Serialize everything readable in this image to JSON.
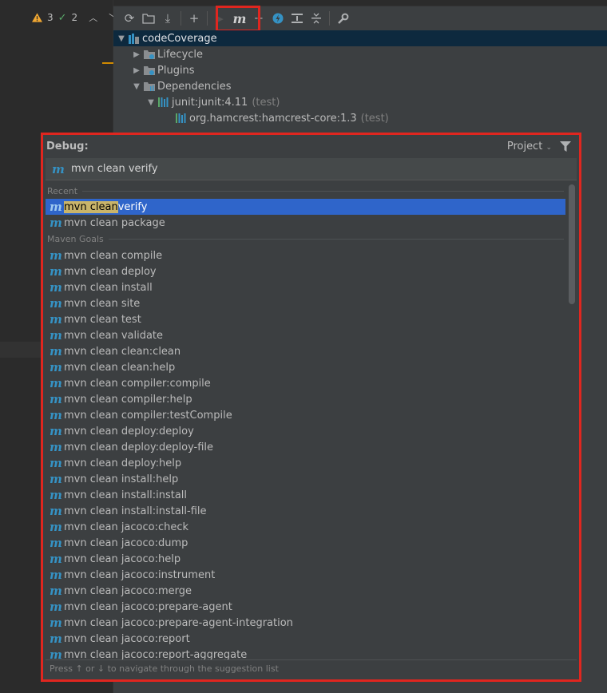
{
  "inspection": {
    "warnings": "3",
    "ok": "2"
  },
  "tree": {
    "project": "codeCoverage",
    "lifecycle": "Lifecycle",
    "plugins": "Plugins",
    "dependencies": "Dependencies",
    "dep1_name": "junit:junit:4.11",
    "dep1_scope": "(test)",
    "dep2_name": "org.hamcrest:hamcrest-core:1.3",
    "dep2_scope": "(test)"
  },
  "popup": {
    "title": "Debug:",
    "project_selector": "Project",
    "command_value": "mvn clean verify",
    "recent_header": "Recent",
    "maven_goals_header": "Maven Goals",
    "selected_match": "mvn clean ",
    "selected_rest": "verify",
    "recent": [
      "mvn clean package"
    ],
    "goals": [
      "mvn clean compile",
      "mvn clean deploy",
      "mvn clean install",
      "mvn clean site",
      "mvn clean test",
      "mvn clean validate",
      "mvn clean clean:clean",
      "mvn clean clean:help",
      "mvn clean compiler:compile",
      "mvn clean compiler:help",
      "mvn clean compiler:testCompile",
      "mvn clean deploy:deploy",
      "mvn clean deploy:deploy-file",
      "mvn clean deploy:help",
      "mvn clean install:help",
      "mvn clean install:install",
      "mvn clean install:install-file",
      "mvn clean jacoco:check",
      "mvn clean jacoco:dump",
      "mvn clean jacoco:help",
      "mvn clean jacoco:instrument",
      "mvn clean jacoco:merge",
      "mvn clean jacoco:prepare-agent",
      "mvn clean jacoco:prepare-agent-integration",
      "mvn clean jacoco:report",
      "mvn clean jacoco:report-aggregate"
    ],
    "hint": "Press ↑ or ↓ to navigate through the suggestion list"
  },
  "icons": {
    "maven": "m",
    "warning": "warning-triangle-icon",
    "ok": "check-icon"
  },
  "colors": {
    "highlight_border": "#e0261f",
    "selection": "#2f65ca",
    "maven_icon": "#3592c4"
  }
}
